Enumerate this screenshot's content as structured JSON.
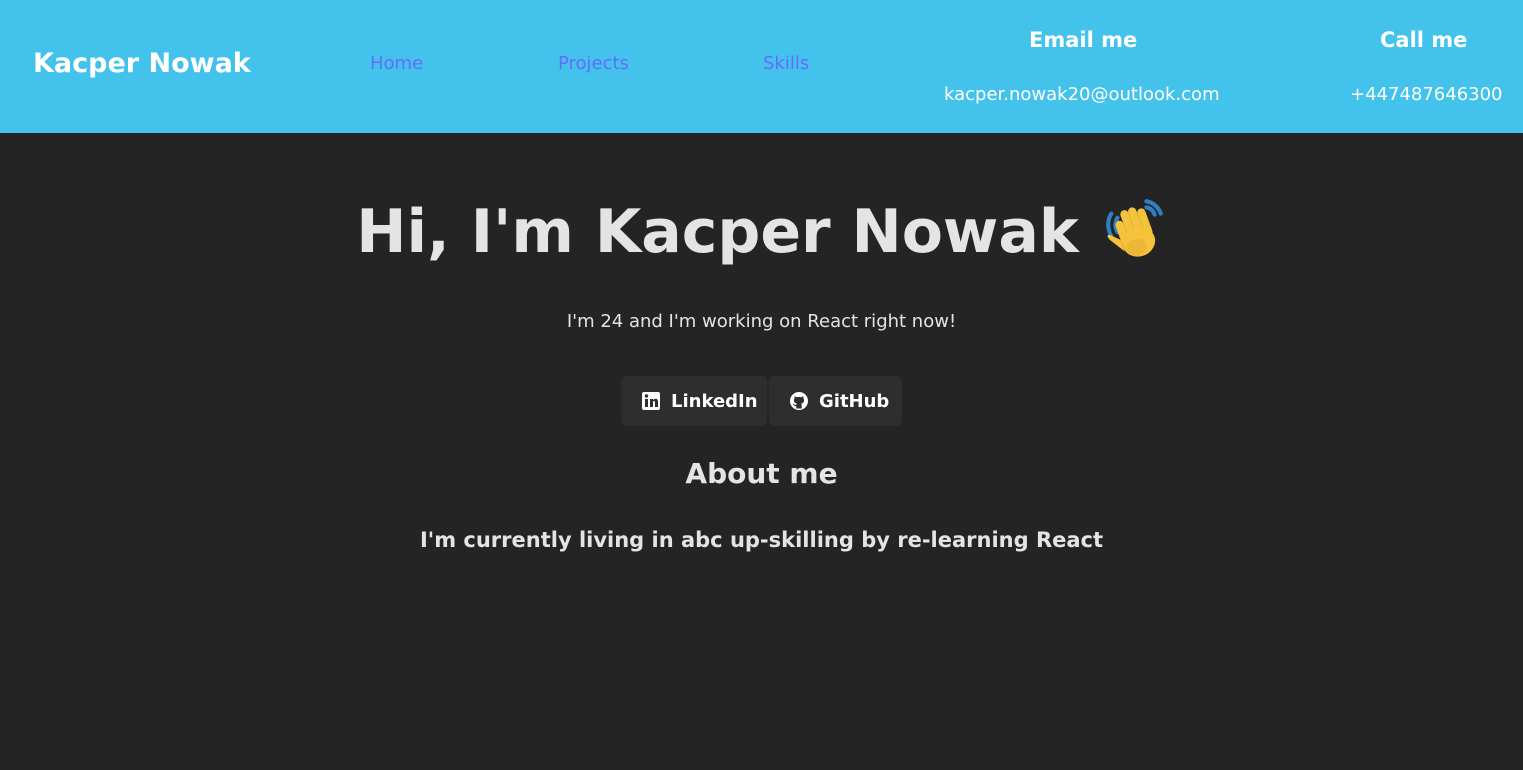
{
  "header": {
    "brand": "Kacper Nowak",
    "nav": [
      {
        "label": "Home"
      },
      {
        "label": "Projects"
      },
      {
        "label": "Skills"
      }
    ],
    "email": {
      "title": "Email me",
      "value": "kacper.nowak20@outlook.com"
    },
    "phone": {
      "title": "Call me",
      "value": "+447487646300"
    }
  },
  "hero": {
    "title": "Hi, I'm Kacper Nowak",
    "wave_icon": "waving-hand-icon",
    "subtitle": "I'm 24 and I'm working on React right now!"
  },
  "social": {
    "linkedin": {
      "label": "LinkedIn",
      "icon": "linkedin-icon"
    },
    "github": {
      "label": "GitHub",
      "icon": "github-icon"
    }
  },
  "about": {
    "title": "About me",
    "text": "I'm currently living in abc up-skilling by re-learning React"
  },
  "colors": {
    "header_bg": "#43c3ec",
    "page_bg": "#242424",
    "nav_link": "#646cff",
    "button_bg": "#2e2e2e",
    "text": "#e4e4e4"
  }
}
